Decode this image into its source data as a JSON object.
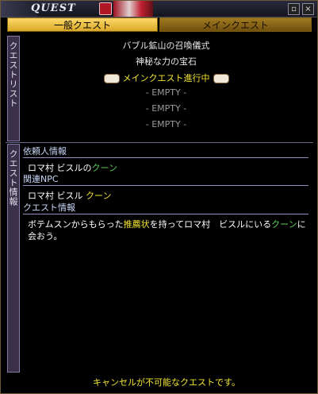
{
  "window": {
    "title": "QUEST"
  },
  "tabs": [
    {
      "label": "一般クエスト",
      "active": true
    },
    {
      "label": "メインクエスト",
      "active": false
    }
  ],
  "side_labels": {
    "list": "クエストリスト",
    "info": "クエスト情報"
  },
  "quest_list": {
    "quest_title": "バブル鉱山の召喚儀式",
    "quest_subtitle": "神秘な力の宝石",
    "main_in_progress": "メインクエスト進行中",
    "empty_slots": [
      "- EMPTY -",
      "- EMPTY -",
      "- EMPTY -"
    ]
  },
  "info": {
    "requester_header": "依頼人情報",
    "requester_prefix": "ロマ村 ビスルの",
    "requester_name": "クーン",
    "related_npc_header": "関連NPC",
    "related_npc_prefix": "ロマ村 ビスル ",
    "related_npc_name": "クーン",
    "quest_info_header": "クエスト情報",
    "description_part1": "ボテムスンからもらった",
    "description_item": "推薦状",
    "description_part2": "を持ってロマ村　ビスルにいる",
    "description_npc": "クーン",
    "description_part3": "に会おう。",
    "footer": "キャンセルが不可能なクエストです。"
  },
  "colors": {
    "accent_yellow": "#f2e630",
    "npc_green": "#5ad05a",
    "tab_gold": "#d8a828"
  }
}
